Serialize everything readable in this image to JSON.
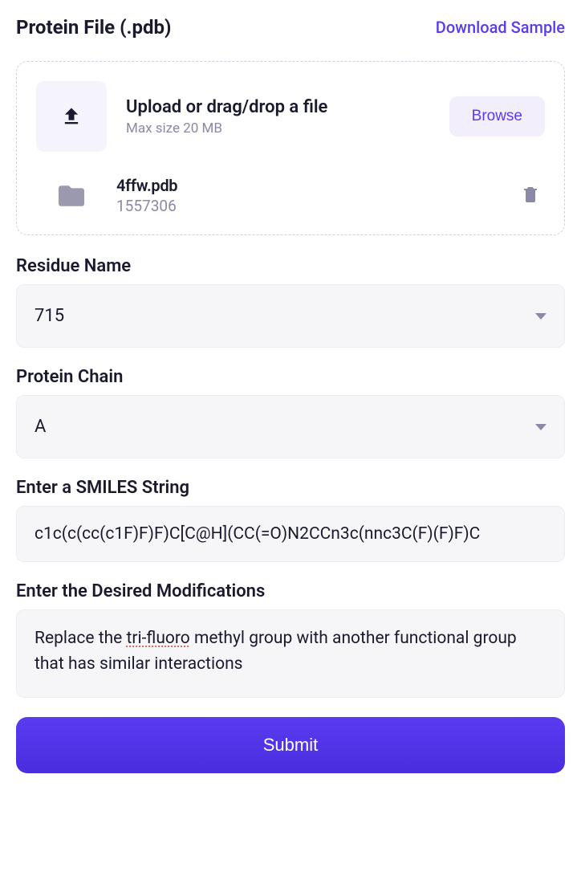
{
  "header": {
    "title": "Protein File (.pdb)",
    "download_label": "Download Sample"
  },
  "upload": {
    "title": "Upload or drag/drop a file",
    "subtitle": "Max size 20 MB",
    "browse_label": "Browse",
    "file": {
      "name": "4ffw.pdb",
      "size": "1557306"
    }
  },
  "fields": {
    "residue_label": "Residue Name",
    "residue_value": "715",
    "chain_label": "Protein Chain",
    "chain_value": "A",
    "smiles_label": "Enter a SMILES String",
    "smiles_value": "c1c(c(cc(c1F)F)F)C[C@H](CC(=O)N2CCn3c(nnc3C(F)(F)F)C",
    "mods_label": "Enter the Desired Modifications",
    "mods_prefix": "Replace the ",
    "mods_spell": "tri-fluoro",
    "mods_suffix": " methyl group with another functional group that has similar interactions"
  },
  "submit_label": "Submit"
}
